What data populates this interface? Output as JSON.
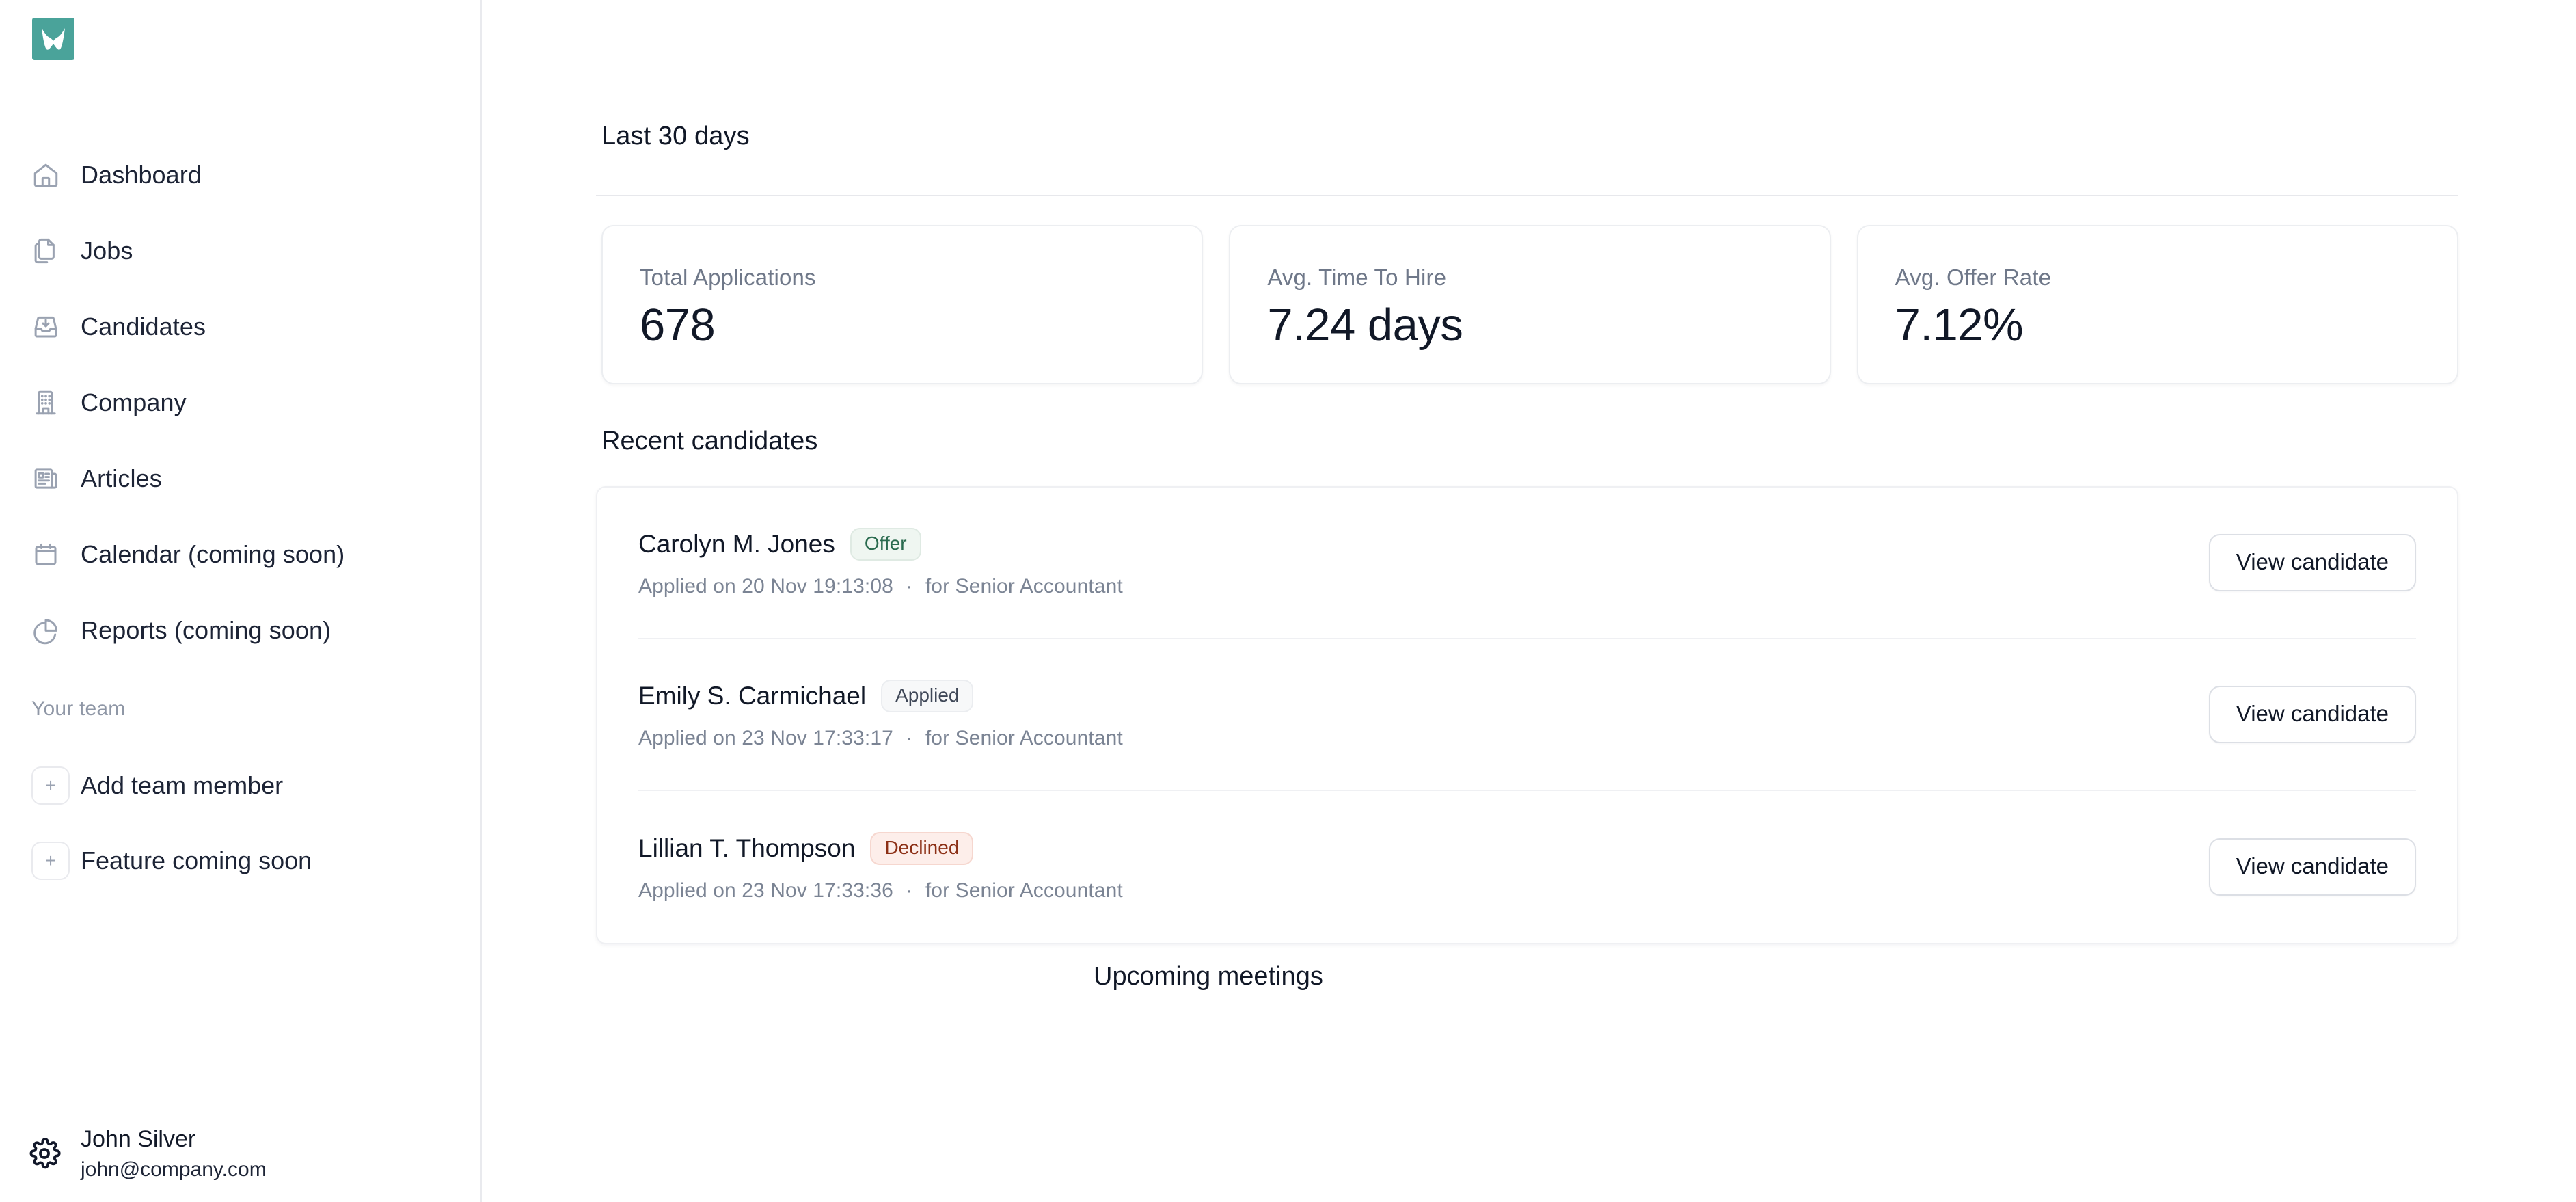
{
  "brand": {
    "logo_icon": "butterfly-logo",
    "logo_color": "#4aa39a"
  },
  "sidebar": {
    "items": [
      {
        "label": "Dashboard",
        "icon": "home-icon"
      },
      {
        "label": "Jobs",
        "icon": "documents-icon"
      },
      {
        "label": "Candidates",
        "icon": "inbox-download-icon"
      },
      {
        "label": "Company",
        "icon": "building-icon"
      },
      {
        "label": "Articles",
        "icon": "newspaper-icon"
      },
      {
        "label": "Calendar (coming soon)",
        "icon": "calendar-icon"
      },
      {
        "label": "Reports (coming soon)",
        "icon": "pie-chart-icon"
      }
    ],
    "team": {
      "heading": "Your team",
      "items": [
        {
          "label": "Add team member",
          "icon": "plus-icon"
        },
        {
          "label": "Feature coming soon",
          "icon": "plus-icon"
        }
      ]
    },
    "profile": {
      "icon": "gear-icon",
      "name": "John Silver",
      "email": "john@company.com"
    }
  },
  "main": {
    "range_title": "Last 30 days",
    "stats": [
      {
        "label": "Total Applications",
        "value": "678"
      },
      {
        "label": "Avg. Time To Hire",
        "value": "7.24 days"
      },
      {
        "label": "Avg. Offer Rate",
        "value": "7.12%"
      }
    ],
    "recent_candidates_title": "Recent candidates",
    "candidates": [
      {
        "name": "Carolyn M. Jones",
        "status": "Offer",
        "status_kind": "offer",
        "applied": "Applied on 20 Nov 19:13:08",
        "separator": "·",
        "role": "for Senior Accountant",
        "action": "View candidate"
      },
      {
        "name": "Emily S. Carmichael",
        "status": "Applied",
        "status_kind": "applied",
        "applied": "Applied on 23 Nov 17:33:17",
        "separator": "·",
        "role": "for Senior Accountant",
        "action": "View candidate"
      },
      {
        "name": "Lillian T. Thompson",
        "status": "Declined",
        "status_kind": "declined",
        "applied": "Applied on 23 Nov 17:33:36",
        "separator": "·",
        "role": "for Senior Accountant",
        "action": "View candidate"
      }
    ],
    "upcoming_meetings_title": "Upcoming meetings"
  },
  "colors": {
    "brand_teal": "#4aa39a",
    "text_primary": "#111827",
    "text_muted": "#7b8494",
    "badge_offer_text": "#2a6b4f",
    "badge_declined_text": "#8c3016",
    "border": "#eceef1"
  }
}
